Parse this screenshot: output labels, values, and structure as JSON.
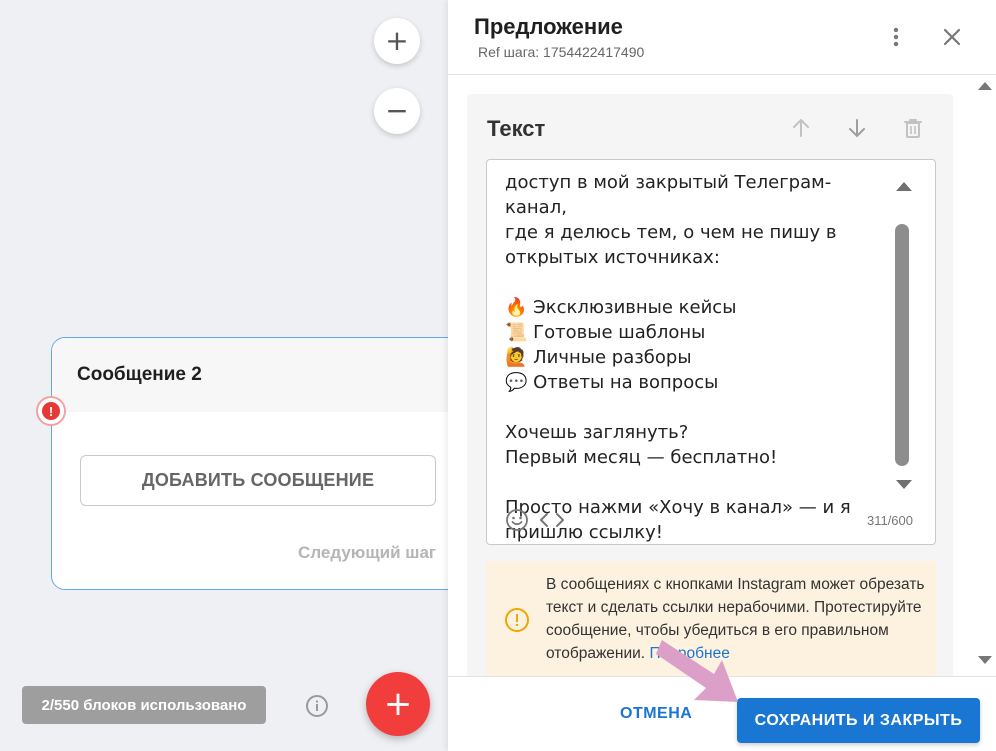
{
  "canvas": {
    "zoom_in": "+",
    "zoom_out": "−",
    "node": {
      "title": "Сообщение 2",
      "add_button": "ДОБАВИТЬ СООБЩЕНИЕ",
      "next_step": "Следующий шаг",
      "error_glyph": "!"
    },
    "usage": "2/550 блоков использовано",
    "fab": "+"
  },
  "panel": {
    "title": "Предложение",
    "ref": "Ref шага: 1754422417490",
    "card": {
      "title": "Текст",
      "text": "доступ в мой закрытый Телеграм-канал,\nгде я делюсь тем, о чем не пишу в\nоткрытых источниках:\n\n🔥 Эксклюзивные кейсы\n📜 Готовые шаблоны\n🙋 Личные разборы\n💬 Ответы на вопросы\n\nХочешь заглянуть?\nПервый месяц — бесплатно!\n\nПросто нажми «Хочу в канал» — и я\nпришлю ссылку!",
      "counter": "311/600"
    },
    "warning": {
      "text": "В сообщениях с кнопками Instagram может обрезать текст и сделать ссылки нерабочими. Протестируйте сообщение, чтобы убедиться в его правильном отображении.",
      "link": "Подробнее"
    },
    "footer": {
      "cancel": "ОТМЕНА",
      "save": "СОХРАНИТЬ И ЗАКРЫТЬ"
    }
  },
  "colors": {
    "accent": "#1976d2",
    "danger": "#f23d3d",
    "warning_bg": "#fdf2e0",
    "node_border": "#64a8ec"
  }
}
